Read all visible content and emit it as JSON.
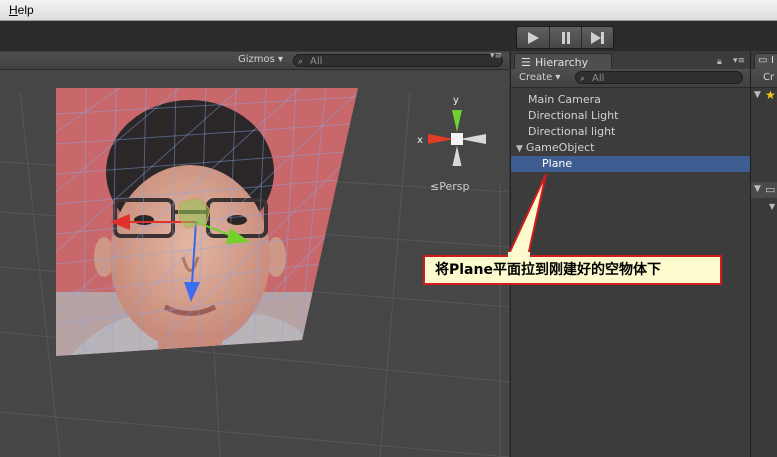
{
  "menubar": {
    "help": "Help",
    "help_mnemonic": "H",
    "help_rest": "elp"
  },
  "toolbar": {
    "play_icon": "play-icon",
    "pause_icon": "pause-icon",
    "step_icon": "step-icon"
  },
  "scene": {
    "gizmos_label": "Gizmos",
    "search_placeholder": "All",
    "gizmo_y": "y",
    "gizmo_x": "x",
    "persp_label": "Persp"
  },
  "hierarchy": {
    "tab_label": "Hierarchy",
    "create_label": "Create",
    "search_placeholder": "All",
    "items": [
      {
        "label": "Main Camera"
      },
      {
        "label": "Directional Light"
      },
      {
        "label": "Directional light"
      },
      {
        "label": "GameObject"
      },
      {
        "label": "Plane"
      }
    ]
  },
  "right_panel": {
    "tab_label": "I",
    "create_label": "Cr"
  },
  "callout": {
    "text": "将Plane平面拉到刚建好的空物体下"
  },
  "colors": {
    "selection": "#3e5e92",
    "callout_border": "#d21c1c",
    "callout_bg": "#fdfbce"
  }
}
